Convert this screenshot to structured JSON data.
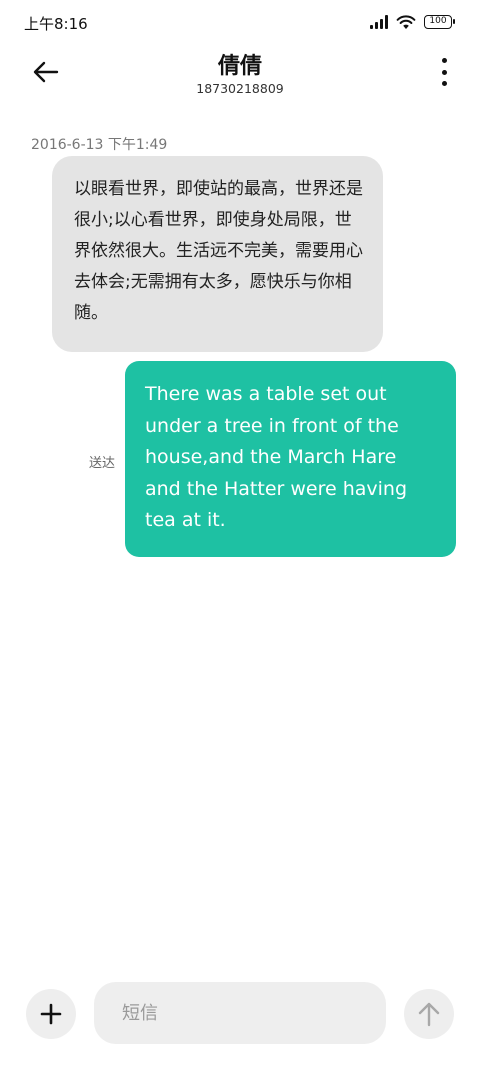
{
  "status_bar": {
    "time": "上午8:16",
    "battery": "100"
  },
  "header": {
    "title": "倩倩",
    "phone": "18730218809"
  },
  "conversation": {
    "timestamp": "2016-6-13 下午1:49",
    "messages": [
      {
        "direction": "incoming",
        "text": "以眼看世界，即使站的最高，世界还是很小;以心看世界，即使身处局限，世界依然很大。生活远不完美，需要用心去体会;无需拥有太多，愿快乐与你相随。"
      },
      {
        "direction": "outgoing",
        "text": "There was a table set out under a tree in front of the house,and the March Hare and the Hatter were having tea at it.",
        "status": "送达"
      }
    ]
  },
  "composer": {
    "placeholder": "短信",
    "value": ""
  },
  "colors": {
    "outgoing_bubble": "#1ec1a3",
    "incoming_bubble": "#e4e4e4",
    "background": "#ffffff"
  },
  "icons": {
    "back": "arrow-left-icon",
    "more": "more-vertical-icon",
    "add": "plus-icon",
    "send": "arrow-up-icon"
  }
}
